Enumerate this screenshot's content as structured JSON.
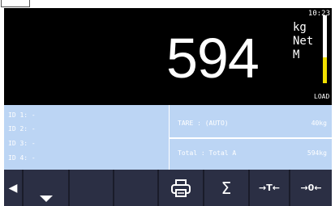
{
  "status": {
    "clock": "10:23"
  },
  "display": {
    "weight": "594",
    "unit": "kg",
    "mode": "Net",
    "indicator": "M",
    "load_label": "LOAD",
    "load_level": 0.38
  },
  "ids": [
    {
      "label": "ID 1: -"
    },
    {
      "label": "ID 2: -"
    },
    {
      "label": "ID 3: -"
    },
    {
      "label": "ID 4: -"
    }
  ],
  "tare": {
    "label": "TARE  : (AUTO)",
    "value": "40kg"
  },
  "total": {
    "label": "Total : Total A",
    "value": "594kg"
  },
  "toolbar": {
    "back_glyph": "◀",
    "down_glyph": "▁",
    "print_icon": "printer-icon",
    "sum_glyph": "Σ",
    "tare_glyph": "→T←",
    "zero_glyph": "→0←"
  },
  "colors": {
    "display_bg": "#000000",
    "panel_bg": "#bcd5f4",
    "toolbar_bg": "#2b2f44",
    "load_bar": "#f1e000"
  }
}
